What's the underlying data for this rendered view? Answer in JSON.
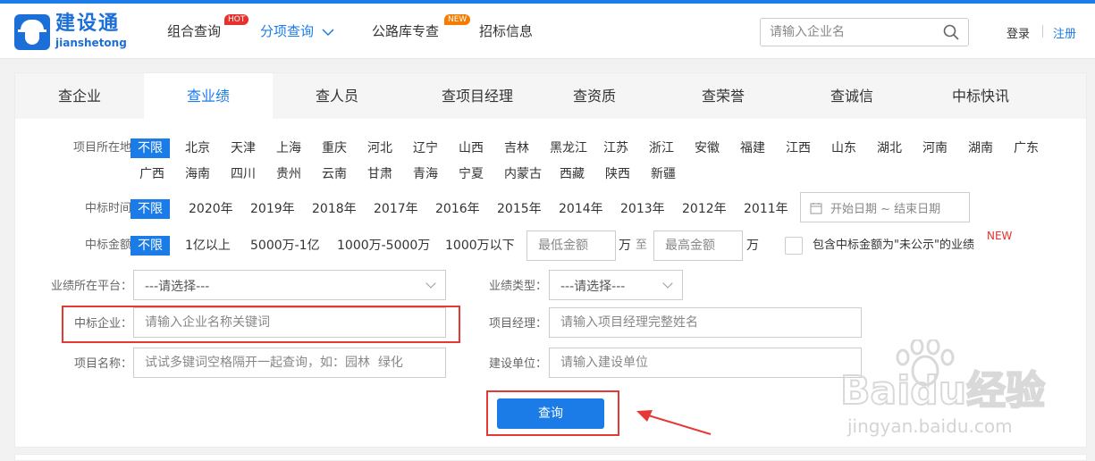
{
  "header": {
    "logo_cn": "建设通",
    "logo_en": "jianshetong",
    "nav": [
      {
        "label": "组合查询",
        "badge": "HOT"
      },
      {
        "label": "分项查询",
        "active": true
      },
      {
        "label": "公路库专查",
        "badge": "NEW"
      },
      {
        "label": "招标信息"
      }
    ],
    "search_placeholder": "请输入企业名",
    "login": "登录",
    "register": "注册"
  },
  "tabs": [
    {
      "label": "查企业"
    },
    {
      "label": "查业绩",
      "active": true
    },
    {
      "label": "查人员"
    },
    {
      "label": "查项目经理"
    },
    {
      "label": "查资质"
    },
    {
      "label": "查荣誉"
    },
    {
      "label": "查诚信"
    },
    {
      "label": "中标快讯"
    }
  ],
  "filters": {
    "location": {
      "label": "项目所在地：",
      "options_row1": [
        "不限",
        "北京",
        "天津",
        "上海",
        "重庆",
        "河北",
        "辽宁",
        "山西",
        "吉林",
        "黑龙江",
        "江苏",
        "浙江",
        "安徽",
        "福建",
        "江西",
        "山东",
        "湖北",
        "河南",
        "湖南",
        "广东"
      ],
      "options_row2": [
        "广西",
        "海南",
        "四川",
        "贵州",
        "云南",
        "甘肃",
        "青海",
        "宁夏",
        "内蒙古",
        "西藏",
        "陕西",
        "新疆"
      ]
    },
    "time": {
      "label": "中标时间：",
      "options": [
        "不限",
        "2020年",
        "2019年",
        "2018年",
        "2017年",
        "2016年",
        "2015年",
        "2014年",
        "2013年",
        "2012年",
        "2011年"
      ],
      "date_placeholder": "开始日期 ~ 结束日期"
    },
    "amount": {
      "label": "中标金额：",
      "options": [
        "不限",
        "1亿以上",
        "5000万-1亿",
        "1000万-5000万",
        "1000万以下"
      ],
      "min_placeholder": "最低金额",
      "max_placeholder": "最高金额",
      "unit": "万",
      "to": "至",
      "checkbox_label": "包含中标金额为\"未公示\"的业绩",
      "new_tag": "NEW"
    },
    "platform": {
      "label": "业绩所在平台：",
      "value": "---请选择---"
    },
    "perf_type": {
      "label": "业绩类型：",
      "value": "---请选择---"
    },
    "company": {
      "label": "中标企业：",
      "placeholder": "请输入企业名称关键词"
    },
    "manager": {
      "label": "项目经理：",
      "placeholder": "请输入项目经理完整姓名"
    },
    "project_name": {
      "label": "项目名称：",
      "placeholder": "试试多键词空格隔开一起查询，如：园林  绿化"
    },
    "builder": {
      "label": "建设单位：",
      "placeholder": "请输入建设单位"
    }
  },
  "query_button": "查询",
  "watermark": {
    "text": "Baidu经验",
    "url": "jingyan.baidu.com"
  },
  "colors": {
    "accent": "#1b7ce8",
    "highlight": "#e53935"
  }
}
